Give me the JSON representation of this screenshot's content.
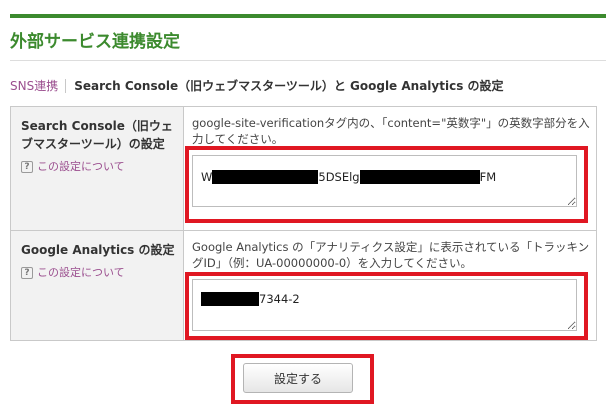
{
  "page_title": "外部サービス連携設定",
  "breadcrumb": {
    "parent": "SNS連携",
    "current": "Search Console（旧ウェブマスターツール）と Google Analytics の設定"
  },
  "rows": [
    {
      "label": "Search Console（旧ウェブマスターツール）の設定",
      "help": "この設定について",
      "description": "google-site-verificationタグ内の、「content=\"英数字\"」の英数字部分を入力してください。",
      "value_visible": [
        "W",
        "5DSElg",
        "FM"
      ]
    },
    {
      "label": "Google Analytics の設定",
      "help": "この設定について",
      "description": "Google Analytics の「アナリティクス設定」に表示されている「トラッキングID」（例：UA-00000000-0）を入力してください。",
      "value_visible": [
        "7344-2"
      ]
    }
  ],
  "submit_label": "設定する",
  "colors": {
    "accent_green": "#3c8a2e",
    "link_purple": "#9b4f8f",
    "highlight_red": "#e01722"
  }
}
